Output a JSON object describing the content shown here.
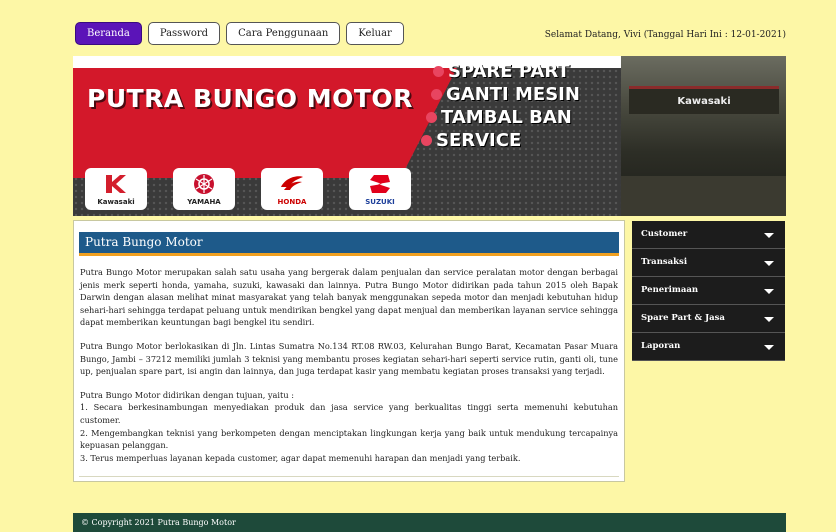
{
  "nav": {
    "items": [
      {
        "label": "Beranda",
        "active": true
      },
      {
        "label": "Password",
        "active": false
      },
      {
        "label": "Cara Penggunaan",
        "active": false
      },
      {
        "label": "Keluar",
        "active": false
      }
    ],
    "welcome": "Selamat Datang, Vivi (Tanggal Hari Ini : 12-01-2021)"
  },
  "banner": {
    "brand": "PUTRA BUNGO MOTOR",
    "services": [
      "SPARE PART",
      "GANTI MESIN",
      "TAMBAL BAN",
      "SERVICE"
    ],
    "logos": [
      {
        "name": "Kawasaki",
        "color": "#d31e2c"
      },
      {
        "name": "YAMAHA",
        "color": "#c8102e"
      },
      {
        "name": "HONDA",
        "color": "#cc0000"
      },
      {
        "name": "SUZUKI",
        "color": "#e1001a"
      }
    ],
    "shop_sign": "Kawasaki",
    "colors": {
      "red": "#d3182a",
      "dark": "#3a3a3a"
    }
  },
  "content": {
    "title": "Putra Bungo Motor",
    "paragraphs": [
      "Putra Bungo Motor merupakan salah satu usaha yang bergerak dalam penjualan dan service peralatan motor dengan berbagai jenis merk seperti honda, yamaha, suzuki, kawasaki dan lainnya. Putra Bungo Motor didirikan pada tahun 2015 oleh Bapak Darwin dengan alasan melihat minat masyarakat yang telah banyak menggunakan sepeda motor dan menjadi kebutuhan hidup sehari-hari sehingga terdapat peluang untuk mendirikan bengkel yang dapat menjual dan memberikan layanan service sehingga dapat memberikan keuntungan bagi bengkel itu sendiri.",
      "Putra Bungo Motor berlokasikan di Jln. Lintas Sumatra No.134 RT.08 RW.03, Kelurahan Bungo Barat, Kecamatan Pasar Muara Bungo, Jambi – 37212 memiliki jumlah 3 teknisi yang membantu proses kegiatan sehari-hari seperti service rutin, ganti oli, tune up, penjualan spare part, isi angin dan lainnya, dan juga terdapat kasir yang membatu kegiatan proses transaksi yang terjadi."
    ],
    "list_intro": "Putra Bungo Motor didirikan dengan tujuan, yaitu :",
    "list": [
      "1. Secara berkesinambungan menyediakan produk dan jasa service yang berkualitas tinggi serta memenuhi kebutuhan customer.",
      "2. Mengembangkan teknisi yang berkompeten dengan menciptakan lingkungan kerja yang baik untuk mendukung tercapainya kepuasan pelanggan.",
      "3. Terus memperluas layanan kepada customer, agar dapat memenuhi harapan dan menjadi yang terbaik."
    ]
  },
  "sidebar": {
    "items": [
      {
        "label": "Customer"
      },
      {
        "label": "Transaksi"
      },
      {
        "label": "Penerimaan"
      },
      {
        "label": "Spare Part & Jasa"
      },
      {
        "label": "Laporan"
      }
    ]
  },
  "footer": {
    "text": "© Copyright 2021 Putra Bungo Motor"
  }
}
